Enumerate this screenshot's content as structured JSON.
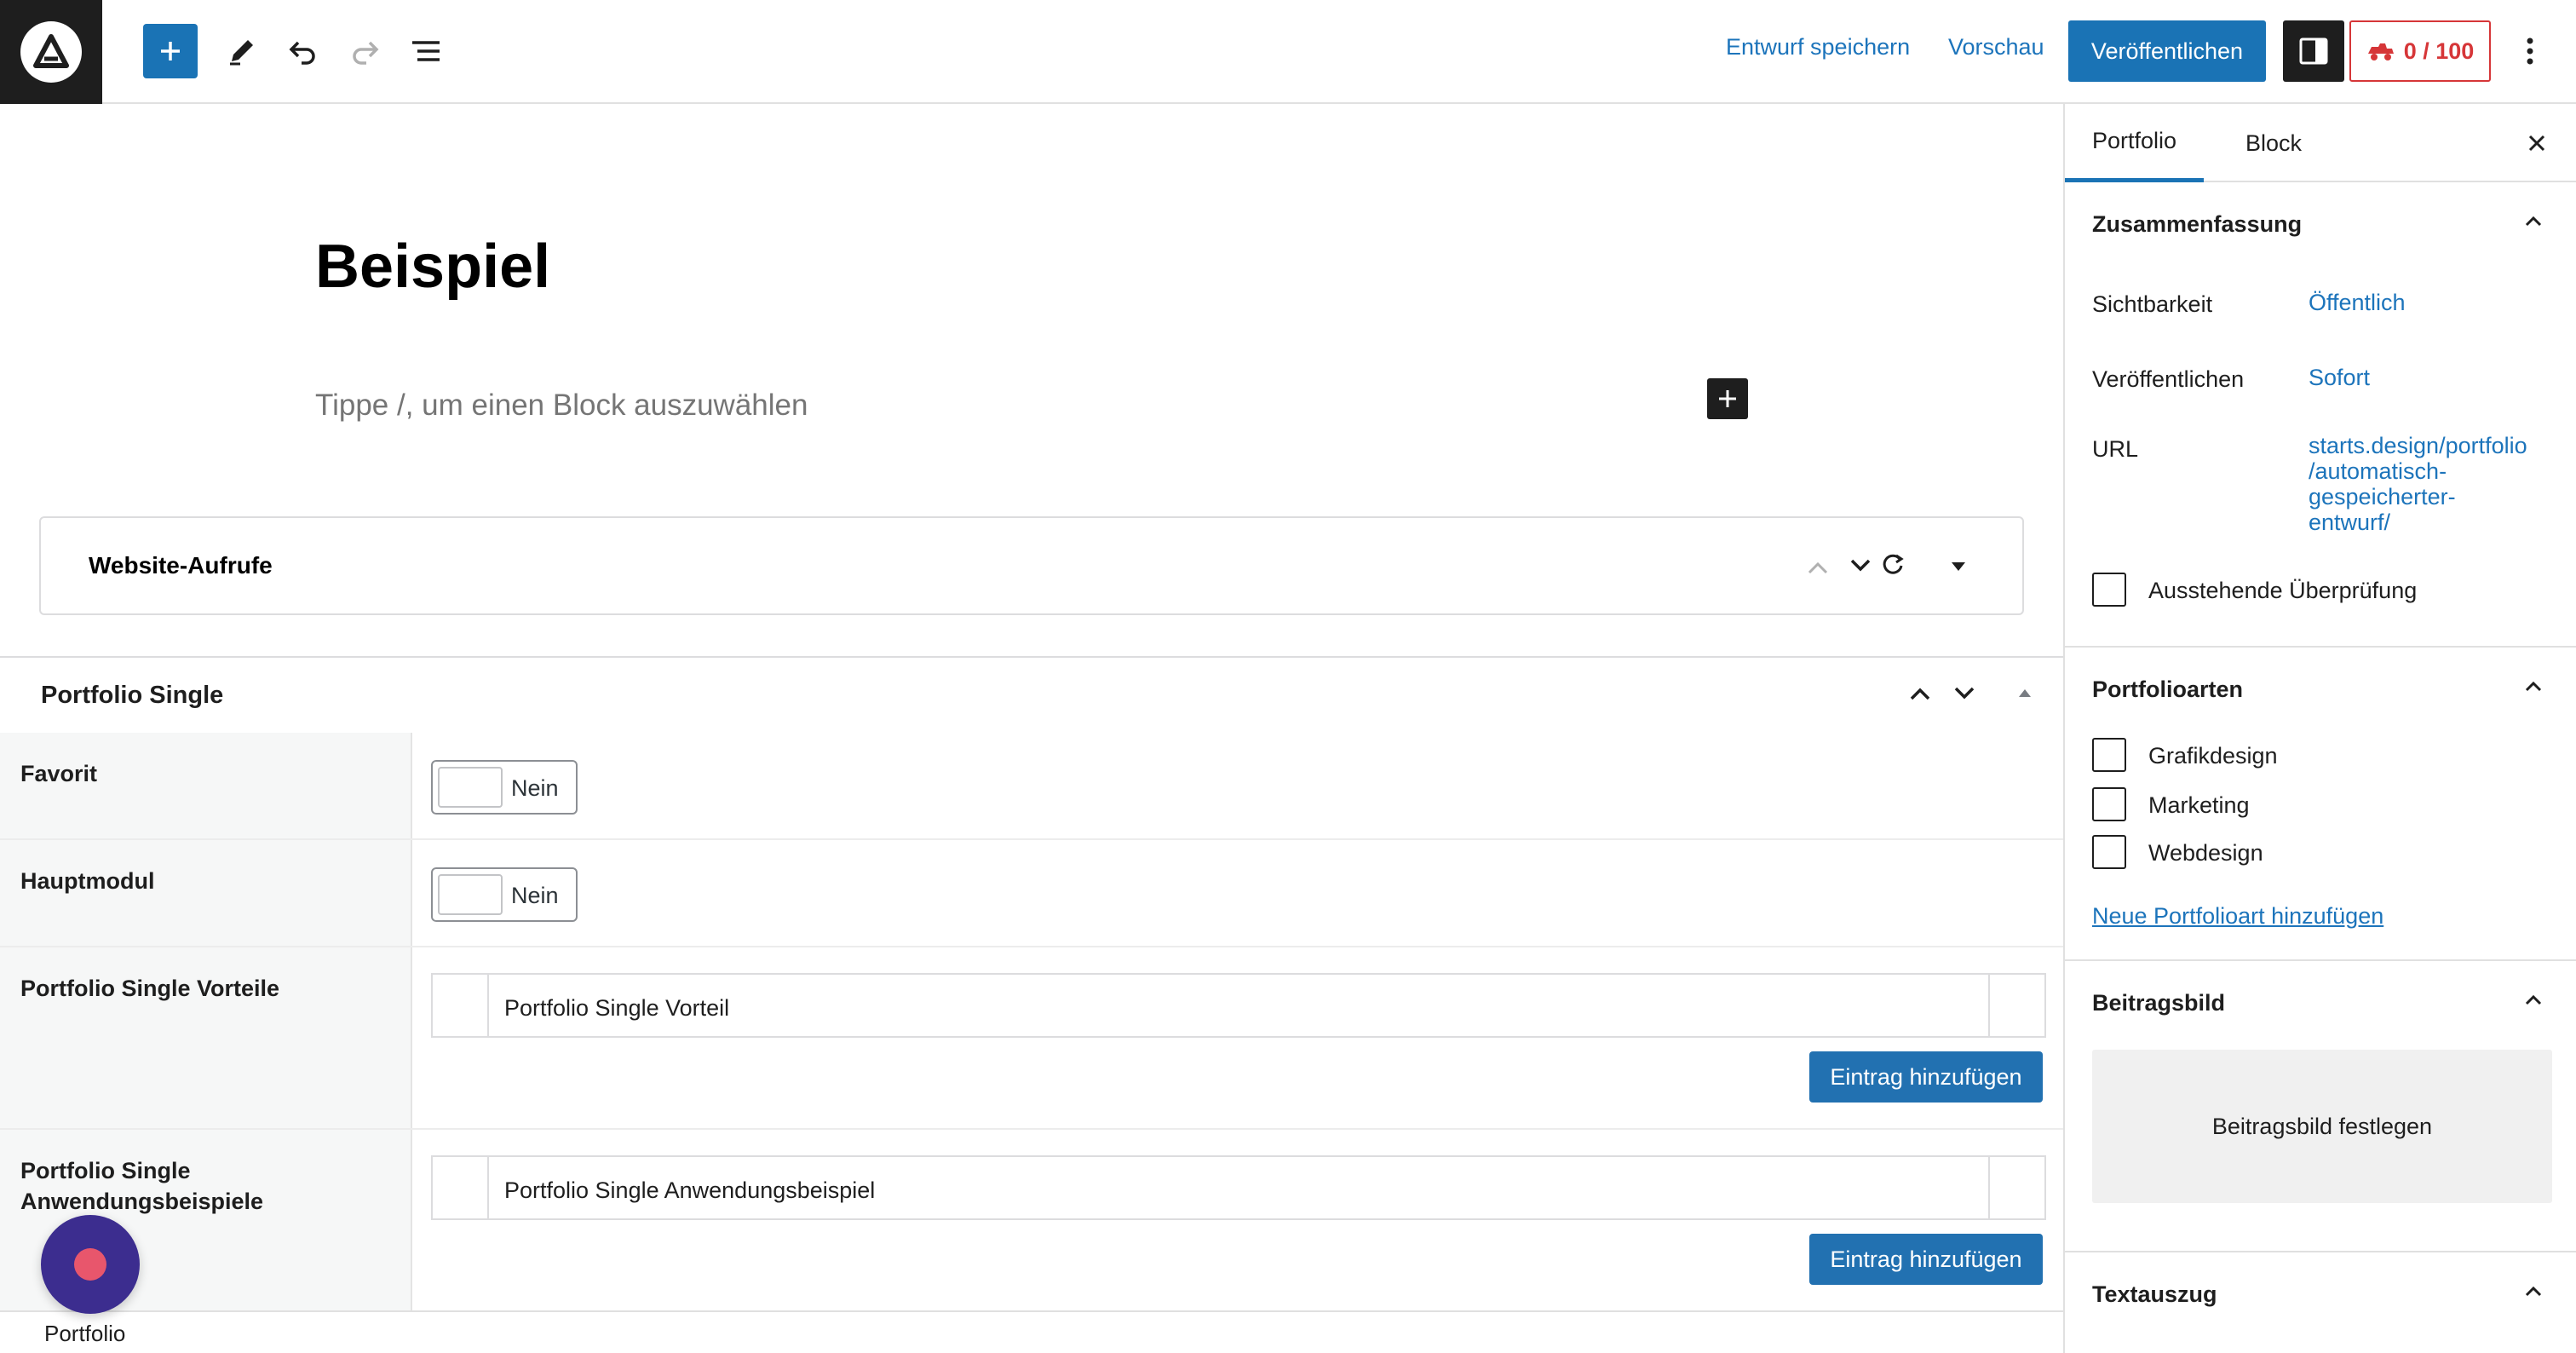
{
  "toolbar": {
    "save_draft": "Entwurf speichern",
    "preview": "Vorschau",
    "publish": "Veröffentlichen",
    "score": "0 / 100",
    "colors": {
      "accent": "#1a73b5",
      "danger": "#d63638"
    }
  },
  "editor": {
    "title": "Beispiel",
    "placeholder": "Tippe /, um einen Block auszuwählen"
  },
  "views_panel": {
    "title": "Website-Aufrufe"
  },
  "meta_box": {
    "title": "Portfolio Single",
    "fields": [
      {
        "label": "Favorit",
        "toggle_text": "Nein"
      },
      {
        "label": "Hauptmodul",
        "toggle_text": "Nein"
      },
      {
        "label": "Portfolio Single Vorteile",
        "item": "Portfolio Single Vorteil",
        "button": "Eintrag hinzufügen"
      },
      {
        "label": "Portfolio Single Anwendungsbeispiele",
        "item": "Portfolio Single Anwendungsbeispiel",
        "button": "Eintrag hinzufügen"
      }
    ]
  },
  "footer": {
    "breadcrumb": "Portfolio"
  },
  "sidebar": {
    "tabs": [
      "Portfolio",
      "Block"
    ],
    "summary": {
      "title": "Zusammenfassung",
      "visibility_label": "Sichtbarkeit",
      "visibility_value": "Öffentlich",
      "publish_label": "Veröffentlichen",
      "publish_value": "Sofort",
      "url_label": "URL",
      "url_lines": [
        "starts.design/portfolio",
        "/automatisch-",
        "gespeicherter-",
        "entwurf/"
      ],
      "pending_review": "Ausstehende Überprüfung"
    },
    "portfolio_types": {
      "title": "Portfolioarten",
      "items": [
        "Grafikdesign",
        "Marketing",
        "Webdesign"
      ],
      "add_link": "Neue Portfolioart hinzufügen"
    },
    "featured_image": {
      "title": "Beitragsbild",
      "button": "Beitragsbild festlegen"
    },
    "excerpt": {
      "title": "Textauszug"
    }
  }
}
